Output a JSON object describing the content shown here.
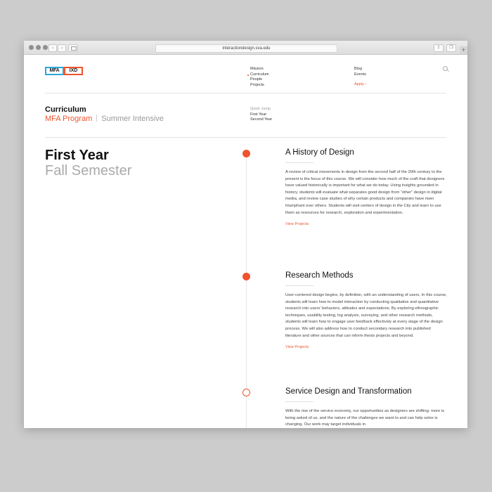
{
  "browser": {
    "url": "interactiondesign.sva.edu",
    "back_glyph": "‹",
    "forward_glyph": "›",
    "share_glyph": "⇪",
    "tabs_glyph": "❐",
    "new_tab_glyph": "+"
  },
  "logo": {
    "left": "MFA",
    "right": "IXD",
    "cross": "X"
  },
  "nav": {
    "col1": [
      "Mission",
      "Curriculum",
      "People",
      "Projects"
    ],
    "active": "Curriculum",
    "col2": [
      "Blog",
      "Events"
    ],
    "apply": "Apply ›"
  },
  "curriculum": {
    "title": "Curriculum",
    "program": "MFA Program",
    "intensive": "Summer Intensive",
    "quick_jump": {
      "label": "Quick Jump",
      "items": [
        "First Year",
        "Second Year"
      ]
    }
  },
  "section": {
    "title": "First Year",
    "subtitle": "Fall Semester"
  },
  "courses": [
    {
      "title": "A History of Design",
      "description": "A review of critical movements in design from the second half of the 20th century to the present is the focus of this course. We will consider how much of the craft that designers have valued historically is important for what we do today. Using insights grounded in history, students will evaluate what separates good design from “other” design in digital media, and review case studies of why certain products and companies have risen triumphant over others. Students will visit centers of design in the City and learn to use them as resources for research, exploration and experimentation.",
      "link": "View Projects"
    },
    {
      "title": "Research Methods",
      "description": "User-centered design begins, by definition, with an understanding of users. In this course, students will learn how to model interaction by conducting qualitative and quantitative research into users’ behaviors, attitudes and expectations. By exploring ethnographic techniques, usability testing, log analysis, surveying, and other research methods, students will learn how to engage user feedback effectively at every stage of the design process. We will also address how to conduct secondary research into published literature and other sources that can inform thesis projects and beyond.",
      "link": "View Projects"
    },
    {
      "title": "Service Design and Transformation",
      "description": "With the rise of the service economy, our opportunities as designers are shifting: more is being asked of us, and the nature of the challenges we want to and can help solve is changing. Our work may target individuals in",
      "link": ""
    }
  ],
  "colors": {
    "accent": "#f0532d",
    "logo_blue": "#2aa8d8",
    "text": "#111111",
    "muted": "#999999"
  }
}
